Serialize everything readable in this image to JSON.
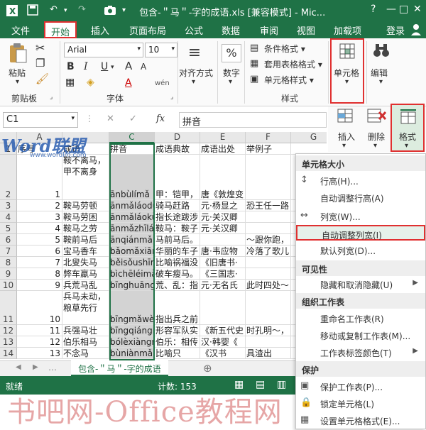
{
  "titlebar": {
    "title": "包含-＂马＂-字的成语.xls  [兼容模式] - Mic...",
    "help": "?",
    "minimize": "—",
    "restore": "□",
    "close": "✕"
  },
  "tabs": [
    {
      "label": "文件"
    },
    {
      "label": "开始"
    },
    {
      "label": "插入"
    },
    {
      "label": "页面布局"
    },
    {
      "label": "公式"
    },
    {
      "label": "数据"
    },
    {
      "label": "审阅"
    },
    {
      "label": "视图"
    },
    {
      "label": "加载项"
    },
    {
      "label": "登录"
    }
  ],
  "ribbon": {
    "paste": "粘贴",
    "clipboard": "剪贴板",
    "font_name": "Arial",
    "font_size": "10",
    "font_group": "字体",
    "bold": "B",
    "italic": "I",
    "underline": "U",
    "grow": "A",
    "shrink": "A",
    "font_color": "A",
    "wen": "wén",
    "align": "对齐方式",
    "number": "数字",
    "percent": "%",
    "cond_format": "条件格式 ▾",
    "table_format": "套用表格格式 ▾",
    "cell_style": "单元格样式 ▾",
    "styles": "样式",
    "cells": "单元格",
    "edit": "编辑"
  },
  "formula": {
    "namebox": "C1",
    "fx": "fx",
    "value": "拼音",
    "cancel": "✕",
    "enter": "✓"
  },
  "cellpanel": {
    "insert": "插入",
    "delete": "删除",
    "format": "格式"
  },
  "grid": {
    "columns": [
      "A",
      "C",
      "D",
      "E",
      "F",
      "G"
    ],
    "rows": [
      {
        "num": "1",
        "a": "序号",
        "b": "成语",
        "c": "拼音",
        "d": "成语典故",
        "e": "成语出处",
        "f": "举例子"
      },
      {
        "num": "2",
        "a": "1",
        "b": "鞍不离马，甲不离身",
        "c": "ānbùlímǎ",
        "d": "甲：铠甲，",
        "e": "唐《敦煌变",
        "f": ""
      },
      {
        "num": "3",
        "a": "2",
        "b": "鞍马劳顿",
        "c": "ānmǎláodù",
        "d": "骑马赶路",
        "e": "元·杨显之",
        "f": "恐王任一路"
      },
      {
        "num": "4",
        "a": "3",
        "b": "鞍马劳困",
        "c": "ānmǎláokù",
        "d": "指长途跋涉",
        "e": "元·关汉卿",
        "f": ""
      },
      {
        "num": "5",
        "a": "4",
        "b": "鞍马之劳",
        "c": "ānmǎzhīlá",
        "d": "鞍马：鞍子",
        "e": "元·关汉卿",
        "f": ""
      },
      {
        "num": "6",
        "a": "5",
        "b": "鞍前马后",
        "c": "ānqiánmǎh",
        "d": "马前马后。",
        "e": "",
        "f": "～跟你跑，"
      },
      {
        "num": "7",
        "a": "6",
        "b": "宝马香车",
        "c": "bǎomǎxiān",
        "d": "华丽的车子",
        "e": "唐·韦应物",
        "f": "冷落了歌儿"
      },
      {
        "num": "8",
        "a": "7",
        "b": "北叟失马",
        "c": "běisǒushīm",
        "d": "比喻祸福没",
        "e": "《旧唐书·",
        "f": ""
      },
      {
        "num": "9",
        "a": "8",
        "b": "弊车羸马",
        "c": "bìchēléimǎ",
        "d": "破车瘦马。",
        "e": "《三国志·",
        "f": ""
      },
      {
        "num": "10",
        "a": "9",
        "b": "兵荒马乱",
        "c": "bīnghuāng",
        "d": "荒、乱：指",
        "e": "元·无名氏",
        "f": "此时四处～"
      },
      {
        "num": "11",
        "a": "10",
        "b": "兵马未动，粮草先行",
        "c": "bīngmǎwèi",
        "d": "指出兵之前",
        "e": "",
        "f": ""
      },
      {
        "num": "12",
        "a": "11",
        "b": "兵强马壮",
        "c": "bīngqiángr",
        "d": "形容军队实",
        "e": "《新五代史",
        "f": "时孔明～，"
      },
      {
        "num": "13",
        "a": "12",
        "b": "伯乐相马",
        "c": "bólèxiàngr",
        "d": "伯乐：相传",
        "e": "汉·韩婴《",
        "f": ""
      },
      {
        "num": "14",
        "a": "13",
        "b": "不念马",
        "c": "bùniànmǎ",
        "d": "比喻只",
        "e": "《汉书",
        "f": "具渣出"
      }
    ]
  },
  "sheetbar": {
    "sheet_name": "包含-＂马＂-字的成语",
    "add": "⊕",
    "nav_left": "◀",
    "nav_right": "▶"
  },
  "status": {
    "ready": "就绪",
    "count": "计数: 153"
  },
  "dropdown": {
    "sec_size": "单元格大小",
    "row_height": "行高(H)...",
    "autofit_row": "自动调整行高(A)",
    "col_width": "列宽(W)...",
    "autofit_col": "自动调整列宽(I)",
    "default_width": "默认列宽(D)...",
    "sec_visibility": "可见性",
    "hide_unhide": "隐藏和取消隐藏(U)",
    "sec_organize": "组织工作表",
    "rename": "重命名工作表(R)",
    "move_copy": "移动或复制工作表(M)...",
    "tab_color": "工作表标签颜色(T)",
    "sec_protect": "保护",
    "protect_sheet": "保护工作表(P)...",
    "lock_cell": "锁定单元格(L)",
    "format_cells": "设置单元格格式(E)..."
  },
  "watermark": {
    "logo": "Word联盟",
    "url": "www.wordlm.com",
    "bottom": "书吧网-Office教程网"
  },
  "colors": {
    "accent": "#1f7246",
    "highlight": "#e03030"
  }
}
